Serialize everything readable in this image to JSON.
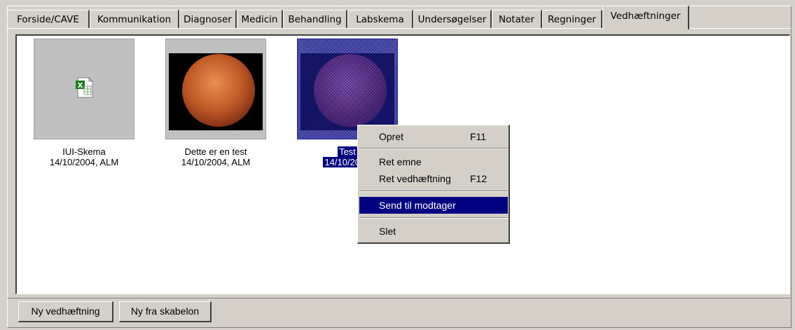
{
  "tabs": [
    {
      "label": "Forside/CAVE"
    },
    {
      "label": "Kommunikation"
    },
    {
      "label": "Diagnoser"
    },
    {
      "label": "Medicin"
    },
    {
      "label": "Behandling"
    },
    {
      "label": "Labskema"
    },
    {
      "label": "Undersøgelser"
    },
    {
      "label": "Notater"
    },
    {
      "label": "Regninger"
    },
    {
      "label": "Vedhæftninger"
    }
  ],
  "attachments": [
    {
      "title": "IUI-Skema",
      "meta": "14/10/2004, ALM",
      "icon": "excel-file-icon"
    },
    {
      "title": "Dette er en test",
      "meta": "14/10/2004, ALM",
      "icon": "endoscopy-image"
    },
    {
      "title": "Test",
      "meta": "14/10/2004",
      "icon": "endoscopy-image"
    }
  ],
  "context_menu": {
    "items": [
      {
        "label": "Opret",
        "shortcut": "F11"
      },
      {
        "label": "Ret emne",
        "shortcut": ""
      },
      {
        "label": "Ret vedhæftning",
        "shortcut": "F12"
      },
      {
        "label": "Send til modtager",
        "shortcut": ""
      },
      {
        "label": "Slet",
        "shortcut": ""
      }
    ]
  },
  "buttons": {
    "new_attachment": "Ny vedhæftning",
    "new_from_template": "Ny fra skabelon"
  },
  "colors": {
    "selection": "#000080",
    "face": "#d4d0c8"
  }
}
